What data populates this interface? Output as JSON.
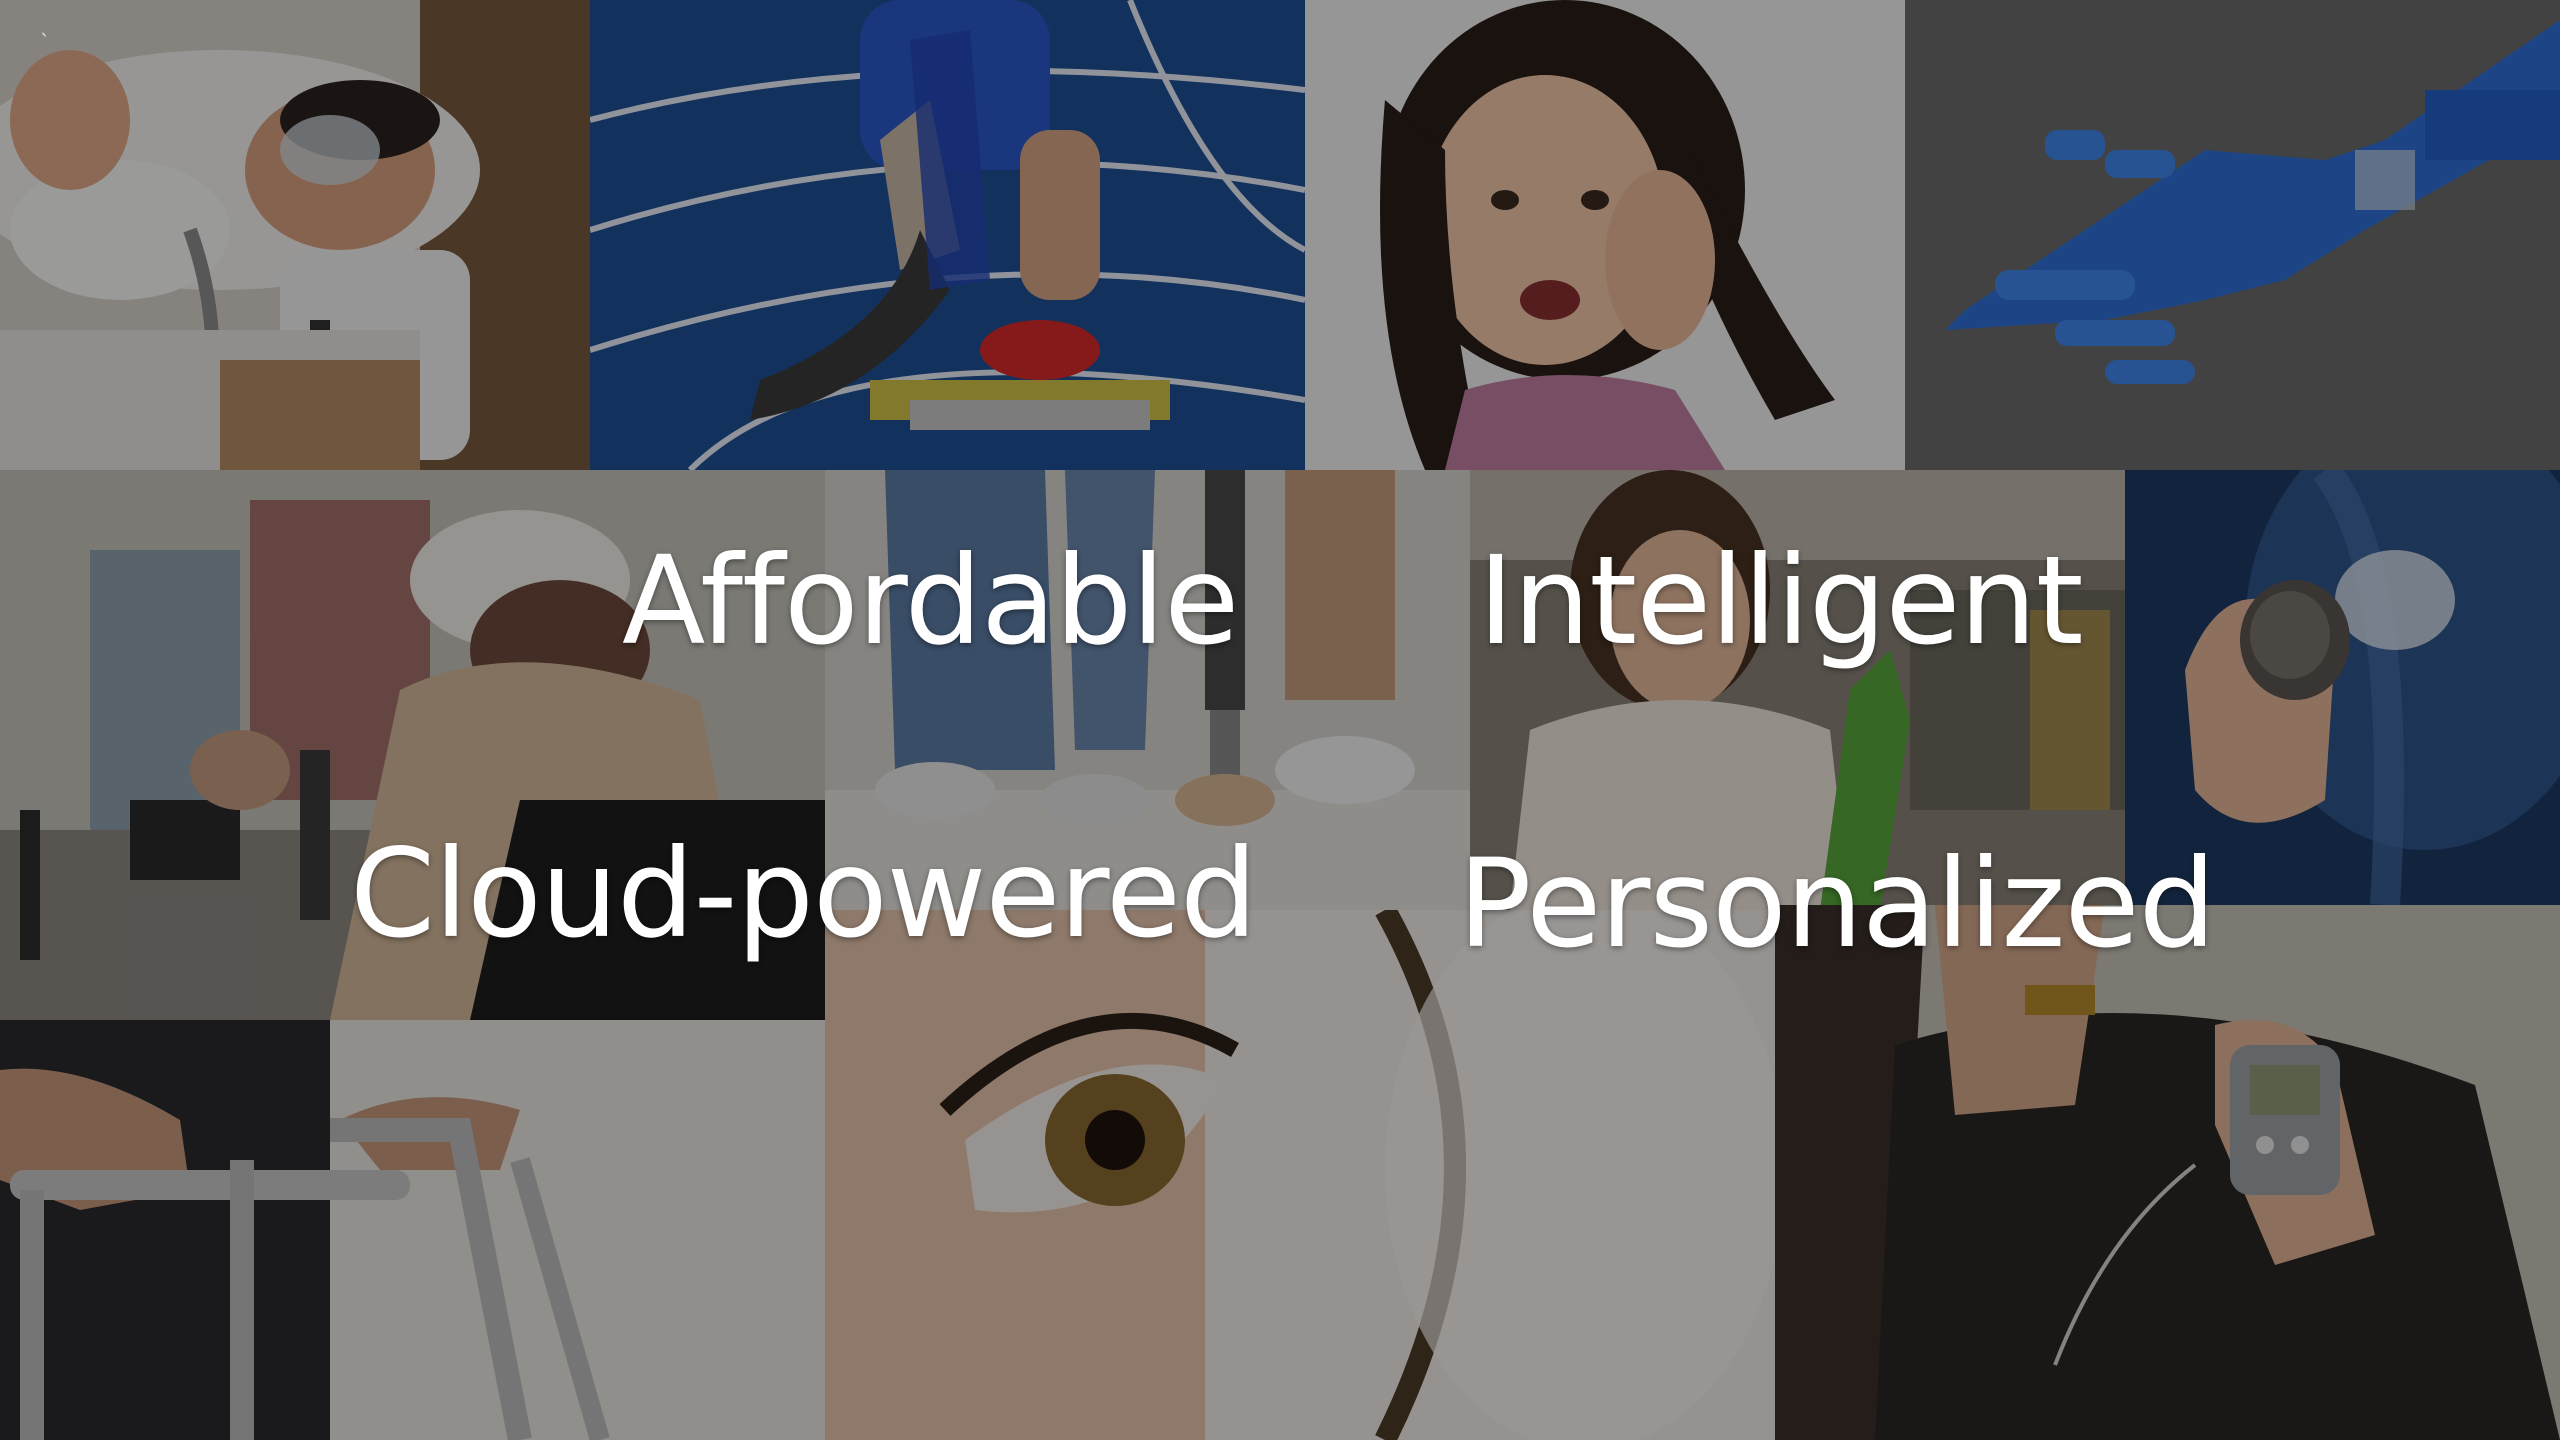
{
  "slide": {
    "words": {
      "affordable": "Affordable",
      "intelligent": "Intelligent",
      "cloud": "Cloud-powered",
      "personalized": "Personalized"
    },
    "corner_mark": "`"
  },
  "photos": [
    "sleep-apnea-mask-photo",
    "prosthetic-runner-photo",
    "girl-hearing-aid-photo",
    "robotic-hand-photo",
    "wheelchair-filming-photo",
    "prosthetic-legs-photo",
    "woman-green-prosthetic-photo",
    "pacemaker-xray-photo",
    "walker-photo",
    "eye-closeup-photo",
    "insulin-pump-photo"
  ]
}
